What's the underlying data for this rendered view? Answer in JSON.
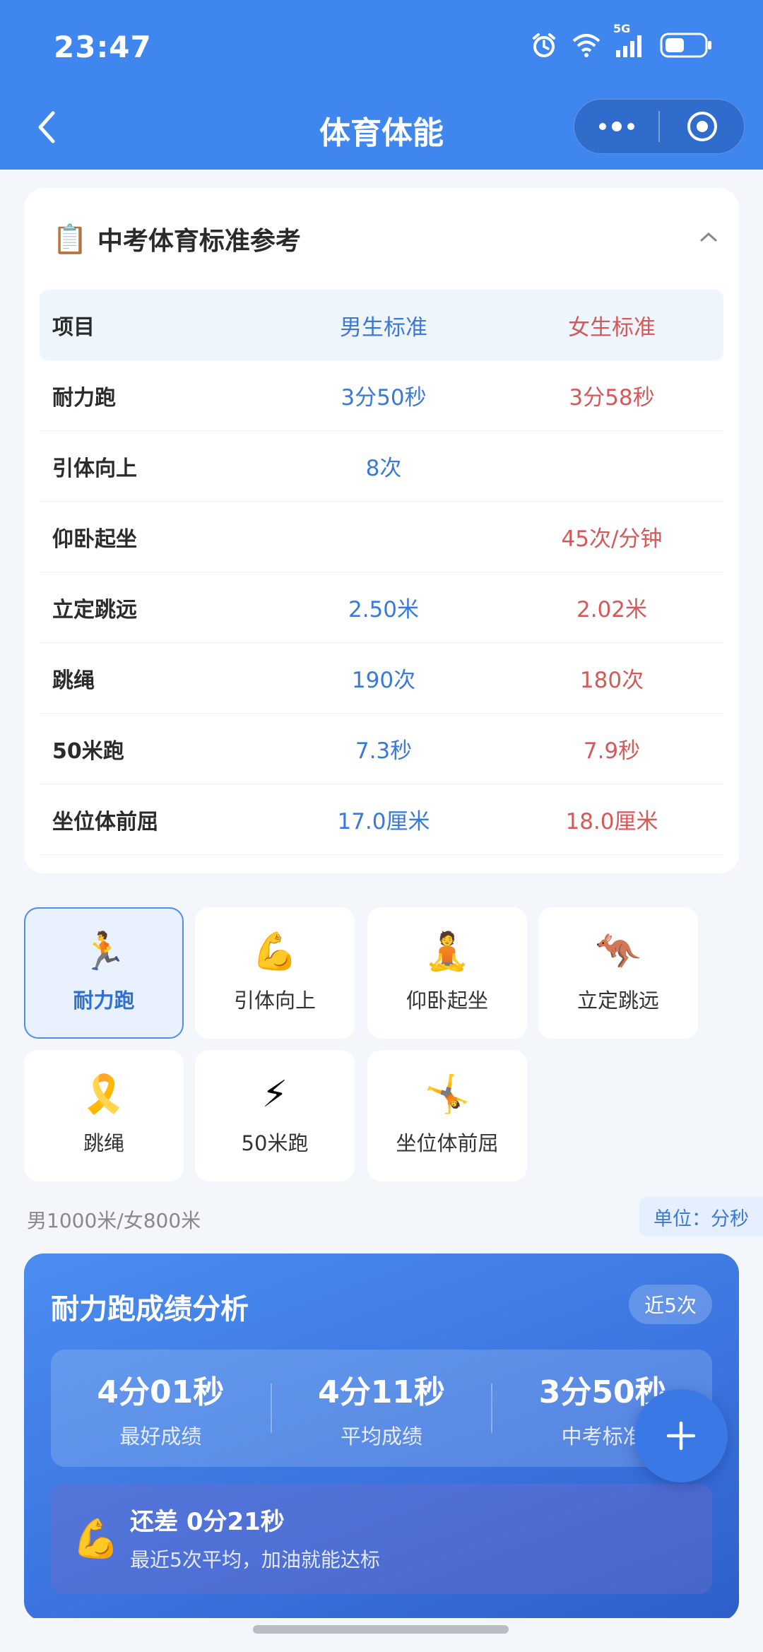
{
  "status": {
    "time": "23:47",
    "network": "5G"
  },
  "titlebar": {
    "title": "体育体能"
  },
  "standards": {
    "title": "中考体育标准参考",
    "title_emoji": "📋",
    "headers": {
      "item": "项目",
      "male": "男生标准",
      "female": "女生标准"
    },
    "rows": [
      {
        "item": "耐力跑",
        "male": "3分50秒",
        "female": "3分58秒"
      },
      {
        "item": "引体向上",
        "male": "8次",
        "female": ""
      },
      {
        "item": "仰卧起坐",
        "male": "",
        "female": "45次/分钟"
      },
      {
        "item": "立定跳远",
        "male": "2.50米",
        "female": "2.02米"
      },
      {
        "item": "跳绳",
        "male": "190次",
        "female": "180次"
      },
      {
        "item": "50米跑",
        "male": "7.3秒",
        "female": "7.9秒"
      },
      {
        "item": "坐位体前屈",
        "male": "17.0厘米",
        "female": "18.0厘米"
      }
    ]
  },
  "tiles": [
    {
      "label": "耐力跑",
      "icon": "🏃",
      "active": true
    },
    {
      "label": "引体向上",
      "icon": "💪",
      "active": false
    },
    {
      "label": "仰卧起坐",
      "icon": "🧘",
      "active": false
    },
    {
      "label": "立定跳远",
      "icon": "🦘",
      "active": false
    },
    {
      "label": "跳绳",
      "icon": "🎗️",
      "active": false
    },
    {
      "label": "50米跑",
      "icon": "⚡",
      "active": false
    },
    {
      "label": "坐位体前屈",
      "icon": "🤸",
      "active": false
    }
  ],
  "hint": {
    "distance": "男1000米/女800米",
    "unit": "单位：分秒"
  },
  "analysis": {
    "title": "耐力跑成绩分析",
    "badge": "近5次",
    "stats": [
      {
        "value": "4分01秒",
        "label": "最好成绩"
      },
      {
        "value": "4分11秒",
        "label": "平均成绩"
      },
      {
        "value": "3分50秒",
        "label": "中考标准"
      }
    ],
    "tip_icon": "💪",
    "tip_main": "还差 0分21秒",
    "tip_sub": "最近5次平均，加油就能达标"
  }
}
